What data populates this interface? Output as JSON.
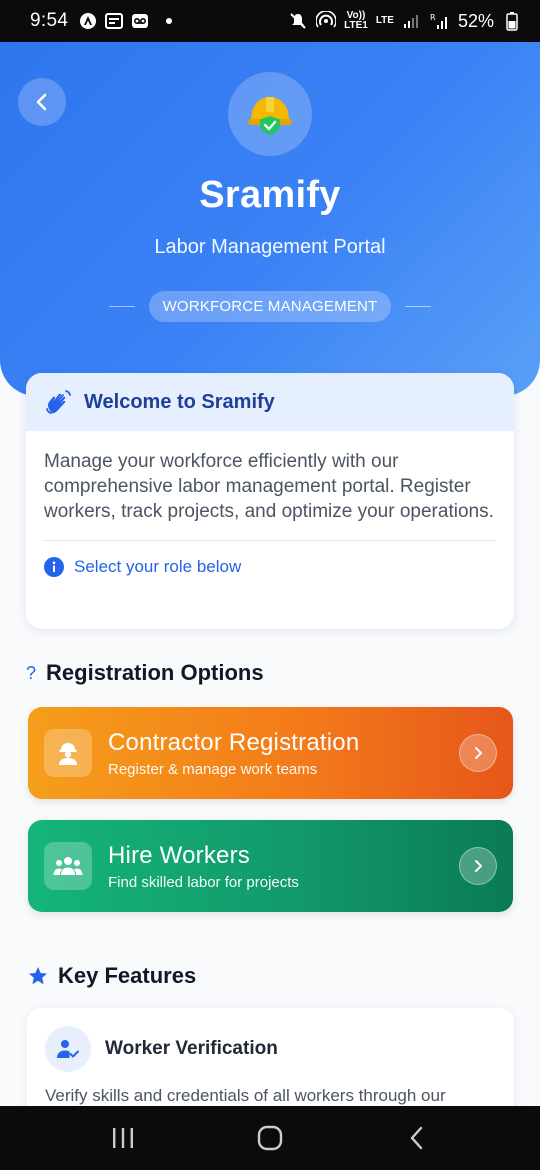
{
  "status_bar": {
    "time": "9:54",
    "volte": "Vo))",
    "lte": "LTE",
    "lte1": "LTE1",
    "battery": "52%"
  },
  "hero": {
    "title": "Sramify",
    "subtitle": "Labor Management Portal",
    "tag": "WORKFORCE MANAGEMENT"
  },
  "welcome": {
    "title": "Welcome to Sramify",
    "body": "Manage your workforce efficiently with our comprehensive labor management portal. Register workers, track projects, and optimize your operations.",
    "hint": "Select your role below"
  },
  "registration": {
    "icon": "?",
    "heading": "Registration Options",
    "options": [
      {
        "title": "Contractor Registration",
        "subtitle": "Register & manage work teams",
        "color": "#f47b1a"
      },
      {
        "title": "Hire Workers",
        "subtitle": "Find skilled labor for projects",
        "color": "#12996a"
      }
    ]
  },
  "features": {
    "heading": "Key Features",
    "items": [
      {
        "title": "Worker Verification",
        "description": "Verify skills and credentials of all workers through our"
      }
    ]
  },
  "colors": {
    "primary": "#3b82f6",
    "accent_blue": "#2563eb",
    "orange": "#f47b1a",
    "green": "#12996a"
  }
}
